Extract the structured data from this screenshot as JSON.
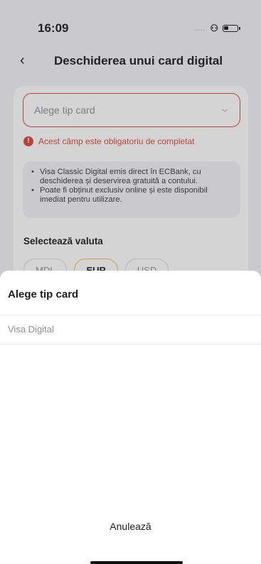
{
  "status": {
    "time": "16:09",
    "dots": "....",
    "link_glyph": "ᘮ"
  },
  "nav": {
    "back_icon": "‹",
    "title": "Deschiderea unui card digital"
  },
  "form": {
    "select_placeholder": "Alege tip card",
    "chevron_icon": "⌄",
    "error_icon": "!",
    "error_text": "Acest câmp este obligatoriu de completat",
    "info": [
      "Visa Classic Digital emis direct în ECBank, cu deschiderea și deservirea gratuită a contului.",
      "Poate fi obținut exclusiv online și este disponibil imediat pentru utilizare."
    ],
    "currency_label": "Selectează valuta",
    "currencies": [
      "MDL",
      "EUR",
      "USD"
    ],
    "selected_currency": "EUR"
  },
  "sheet": {
    "title": "Alege tip card",
    "options": [
      "Visa Digital"
    ],
    "cancel_label": "Anulează"
  },
  "colors": {
    "error": "#d9473f",
    "selected_chip": "#f0c24a"
  }
}
